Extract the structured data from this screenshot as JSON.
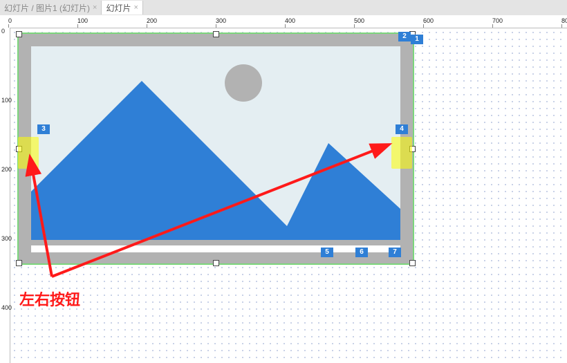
{
  "tabs": [
    {
      "label": "幻灯片 / 图片1 (幻灯片)",
      "active": false
    },
    {
      "label": "幻灯片",
      "active": true
    }
  ],
  "ruler": {
    "h_ticks": [
      0,
      100,
      200,
      300,
      400,
      500,
      600,
      700,
      800
    ],
    "v_ticks": [
      0,
      100,
      200,
      300,
      400
    ]
  },
  "badges": {
    "b1": "1",
    "b2": "2",
    "b3": "3",
    "b4": "4",
    "b5": "5",
    "b6": "6",
    "b7": "7"
  },
  "annotation": {
    "label": "左右按钮"
  },
  "colors": {
    "accent": "#2f7fd6",
    "selection": "#7cd67c",
    "highlight": "#ffff00",
    "arrow": "#ff1a1a"
  }
}
